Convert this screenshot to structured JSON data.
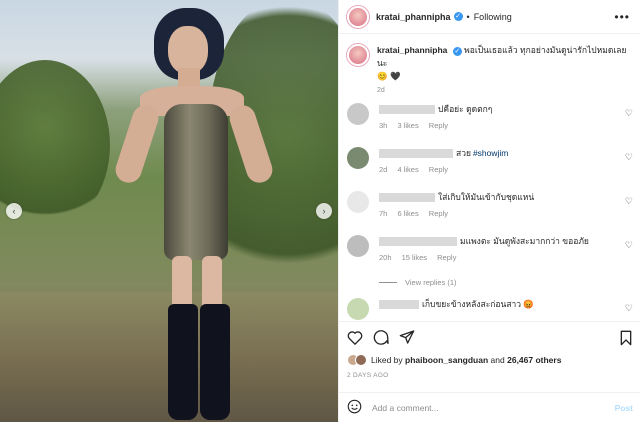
{
  "header": {
    "username": "kratai_phannipha",
    "separator": "•",
    "follow_label": "Following",
    "more_icon": "more-icon"
  },
  "caption": {
    "username": "kratai_phannipha",
    "text": "พอเป็นเธอแล้ว ทุกอย่างมันดูน่ารักไปหมดเลยนะ",
    "emoji": "😊 🖤",
    "time": "2d"
  },
  "comments": [
    {
      "text": "ปคือย่ะ ดูดตกๆ",
      "time": "3h",
      "likes": "3 likes",
      "reply": "Reply",
      "avatar_color": "#c8c8c8"
    },
    {
      "text": "สวย",
      "hashtag": "#showjim",
      "time": "2d",
      "likes": "4 likes",
      "reply": "Reply",
      "avatar_color": "#7a8a70"
    },
    {
      "text": "ใส่เกิบให้มันเข้ากับชุดแหน่",
      "time": "7h",
      "likes": "6 likes",
      "reply": "Reply",
      "avatar_color": "#e8e8e8"
    },
    {
      "text": "มแพงตะ มันดูพังสะมากกว่า ขออภัย",
      "time": "20h",
      "likes": "15 likes",
      "reply": "Reply",
      "avatar_color": "#bdbdbd",
      "view_replies": "View replies (1)"
    },
    {
      "text": "เก็บขยะข้างหลังสะก่อนสาว 😡",
      "avatar_color": "#c6d9b0"
    }
  ],
  "actions": {
    "liked_by_prefix": "Liked by",
    "liked_by_user": "phaiboon_sangduan",
    "liked_by_and": "and",
    "liked_by_count": "26,467 others",
    "post_time": "2 DAYS AGO"
  },
  "add_comment": {
    "placeholder": "Add a comment...",
    "post_label": "Post"
  },
  "colors": {
    "verified": "#3897f0",
    "hashtag": "#00376b",
    "post_button": "#b2dffc",
    "meta_gray": "#8e8e8e"
  }
}
